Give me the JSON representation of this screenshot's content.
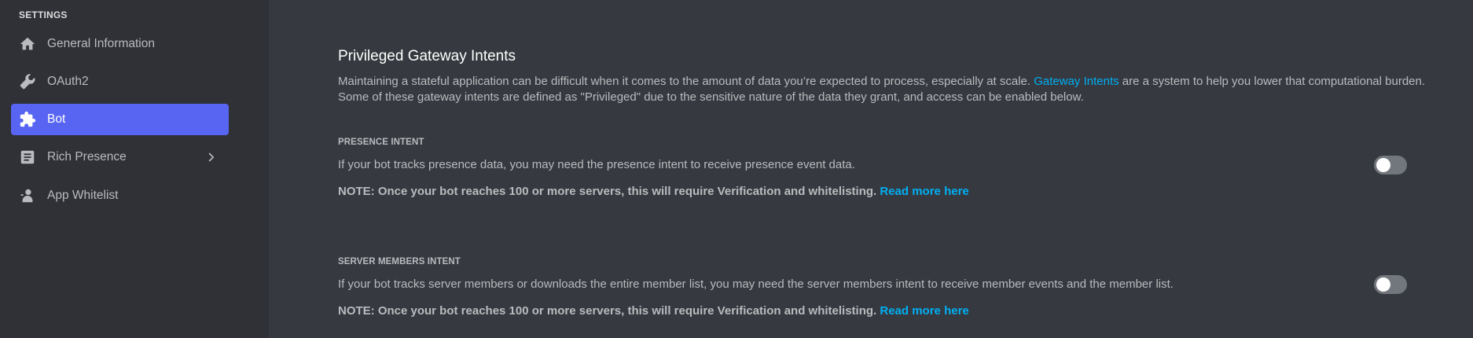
{
  "sidebar": {
    "heading": "SETTINGS",
    "items": [
      {
        "label": "General Information",
        "icon": "home-icon",
        "active": false
      },
      {
        "label": "OAuth2",
        "icon": "wrench-icon",
        "active": false
      },
      {
        "label": "Bot",
        "icon": "puzzle-icon",
        "active": true
      },
      {
        "label": "Rich Presence",
        "icon": "document-icon",
        "active": false,
        "has_submenu": true
      },
      {
        "label": "App Whitelist",
        "icon": "person-icon",
        "active": false
      }
    ]
  },
  "main": {
    "title": "Privileged Gateway Intents",
    "description_before": "Maintaining a stateful application can be difficult when it comes to the amount of data you’re expected to process, especially at scale. ",
    "description_link": "Gateway Intents",
    "description_after": " are a system to help you lower that computational burden. Some of these gateway intents are defined as \"Privileged\" due to the sensitive nature of the data they grant, and access can be enabled below.",
    "intents": [
      {
        "heading": "PRESENCE INTENT",
        "description": "If your bot tracks presence data, you may need the presence intent to receive presence event data.",
        "note": "NOTE: Once your bot reaches 100 or more servers, this will require Verification and whitelisting.",
        "note_link": "Read more here",
        "enabled": false
      },
      {
        "heading": "SERVER MEMBERS INTENT",
        "description": "If your bot tracks server members or downloads the entire member list, you may need the server members intent to receive member events and the member list.",
        "note": "NOTE: Once your bot reaches 100 or more servers, this will require Verification and whitelisting.",
        "note_link": "Read more here",
        "enabled": false
      }
    ]
  },
  "colors": {
    "accent": "#5865f2",
    "link": "#00aff4",
    "background": "#36393f",
    "sidebar": "#2f3136",
    "toggle_off": "#72767d"
  }
}
